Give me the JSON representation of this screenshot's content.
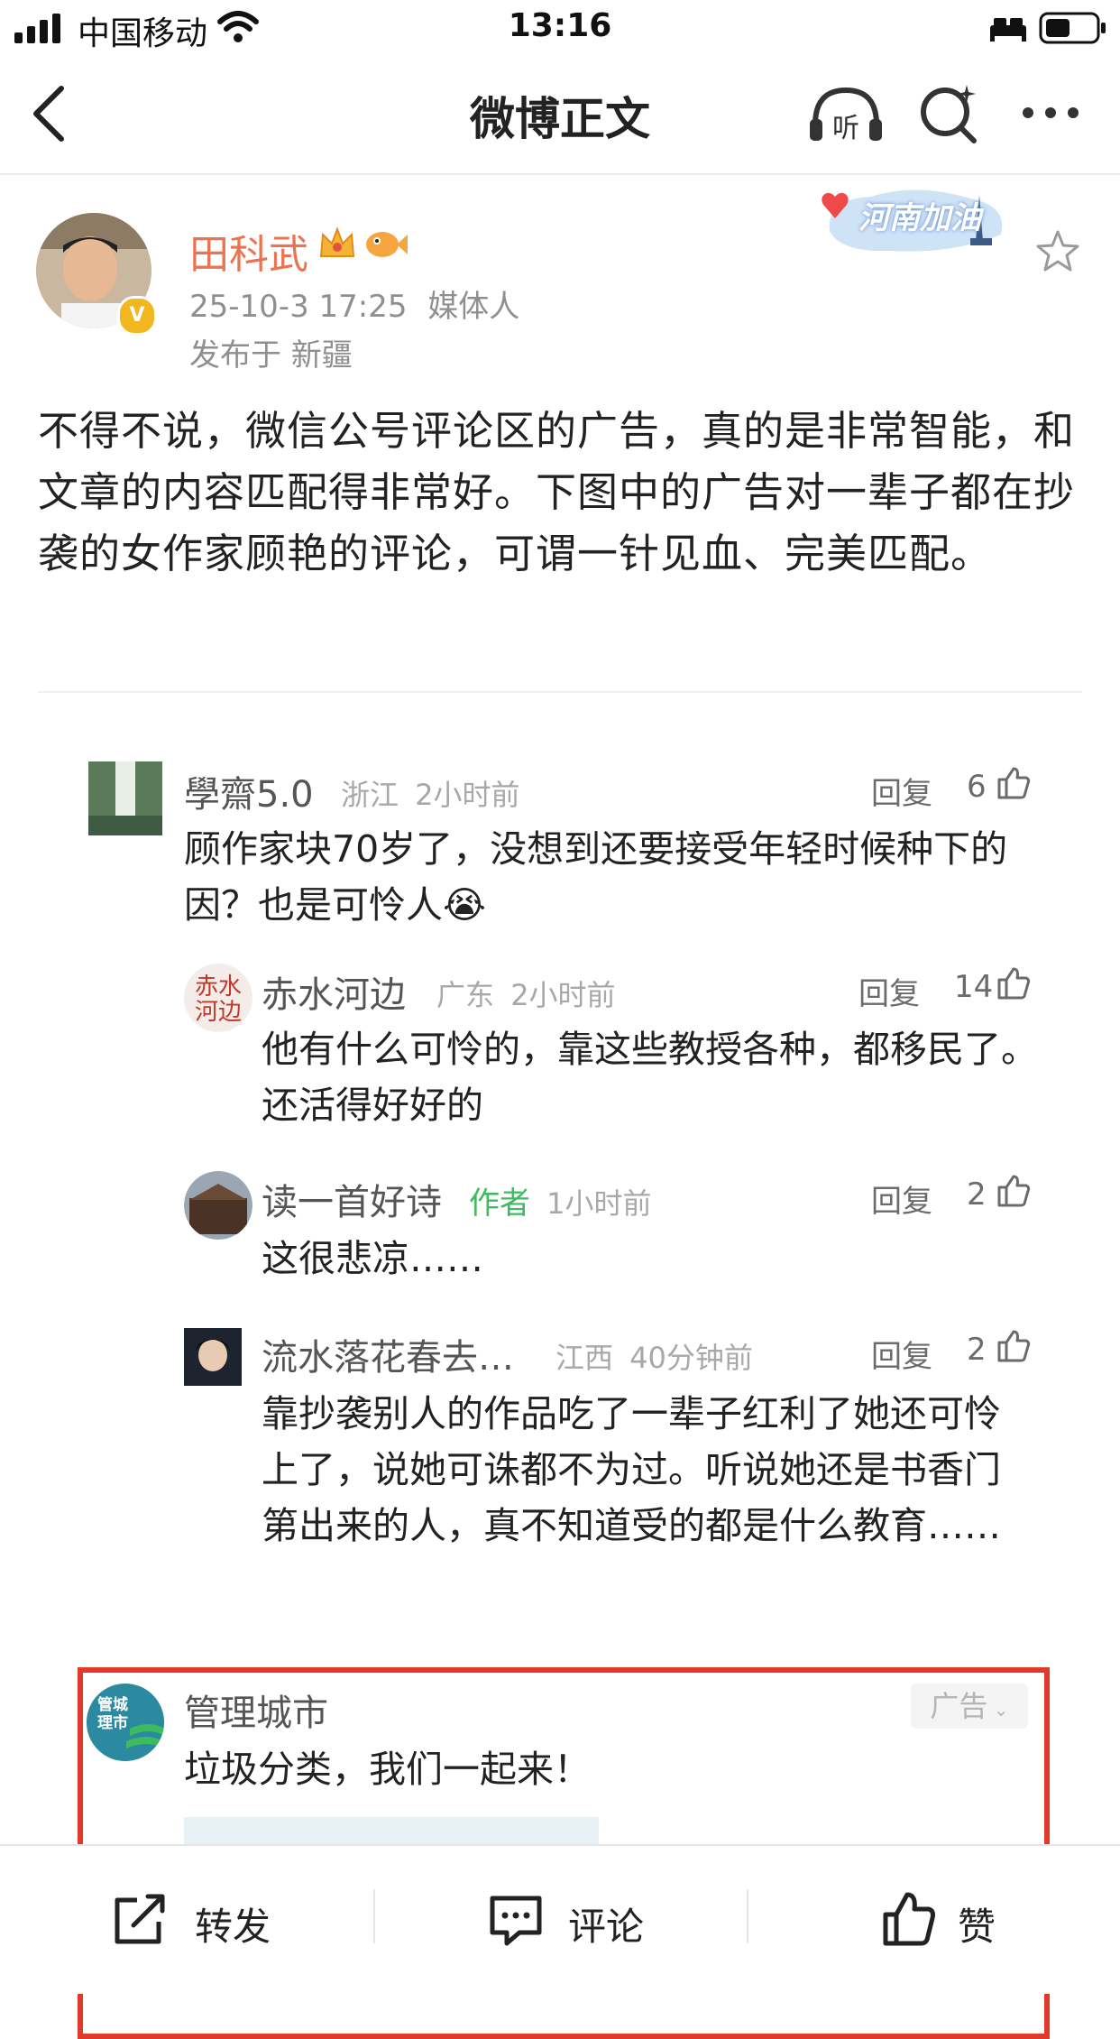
{
  "status_bar": {
    "carrier": "中国移动",
    "time": "13:16"
  },
  "nav": {
    "title": "微博正文"
  },
  "post": {
    "author": "田科武",
    "timestamp": "25-10-3 17:25",
    "role": "媒体人",
    "location": "发布于 新疆",
    "sticker_text": "河南加油",
    "body": "不得不说，微信公号评论区的广告，真的是非常智能，和文章的内容匹配得非常好。下图中的广告对一辈子都在抄袭的女作家顾艳的评论，可谓一针见血、完美匹配。"
  },
  "comments": [
    {
      "name": "學齋5.0",
      "region": "浙江",
      "time": "2小时前",
      "reply_label": "回复",
      "likes": "6",
      "text": "顾作家块70岁了，没想到还要接受年轻时候种下的因？也是可怜人😭"
    },
    {
      "name": "赤水河边",
      "region": "广东",
      "time": "2小时前",
      "reply_label": "回复",
      "likes": "14",
      "text": "他有什么可怜的，靠这些教授各种，都移民了。还活得好好的"
    },
    {
      "name": "读一首好诗",
      "tag": "作者",
      "time": "1小时前",
      "reply_label": "回复",
      "likes": "2",
      "text": "这很悲凉……"
    },
    {
      "name": "流水落花春去…",
      "region": "江西",
      "time": "40分钟前",
      "reply_label": "回复",
      "likes": "2",
      "text": "靠抄袭别人的作品吃了一辈子红利了她还可怜上了，说她可诛都不为过。听说她还是书香门第出来的人，真不知道受的都是什么教育……"
    }
  ],
  "ad": {
    "name": "管理城市",
    "badge": "广告",
    "text": "垃圾分类，我们一起来！",
    "logo_text": "管城理市"
  },
  "toolbar": {
    "repost": "转发",
    "comment": "评论",
    "like": "赞"
  },
  "colors": {
    "author_name": "#eb7350",
    "author_tag": "#3dbb5e",
    "ad_border": "#e13a2a"
  }
}
